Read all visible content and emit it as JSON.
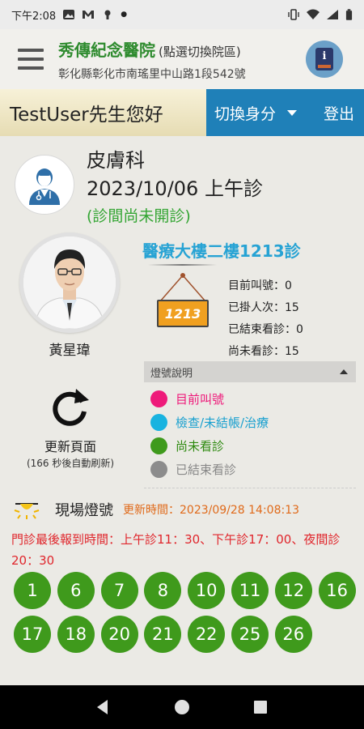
{
  "status_bar": {
    "time": "下午2:08"
  },
  "header": {
    "hospital_name": "秀傳紀念醫院",
    "switch_hint": "(點選切換院區)",
    "address": "彰化縣彰化市南瑤里中山路1段542號"
  },
  "user_bar": {
    "greeting": "TestUser先生您好",
    "switch_identity": "切換身分",
    "logout": "登出"
  },
  "clinic": {
    "department": "皮膚科",
    "date_session": "2023/10/06 上午診",
    "status": "(診間尚未開診)"
  },
  "doctor": {
    "name": "黃星瑋"
  },
  "room": {
    "title": "醫療大樓二樓1213診",
    "number": "1213"
  },
  "stats": [
    "目前叫號：0",
    "已掛人次：15",
    "已結束看診：0",
    "尚未看診：15"
  ],
  "legend": {
    "header": "燈號說明",
    "items": [
      {
        "label": "目前叫號",
        "color": "#ee1a7a"
      },
      {
        "label": "檢查/未結帳/治療",
        "color": "#19b3e0"
      },
      {
        "label": "尚未看診",
        "color": "#3f9a1c"
      },
      {
        "label": "已結束看診",
        "color": "#8c8c8c"
      }
    ]
  },
  "refresh": {
    "label": "更新頁面",
    "countdown": "(166 秒後自動刷新)"
  },
  "live": {
    "title": "現場燈號",
    "update_time": "更新時間：2023/09/28 14:08:13",
    "last_registration": "門診最後報到時間：上午診11：30、下午診17：00、夜間診20：30",
    "numbers": [
      "1",
      "6",
      "7",
      "8",
      "10",
      "11",
      "12",
      "16",
      "17",
      "18",
      "20",
      "21",
      "22",
      "25",
      "26"
    ]
  },
  "colors": {
    "accent_blue": "#1f80b8",
    "hospital_green": "#2e8b2e",
    "number_green": "#3f9a1c",
    "alert_red": "#e0262c",
    "update_orange": "#e06a1a"
  }
}
